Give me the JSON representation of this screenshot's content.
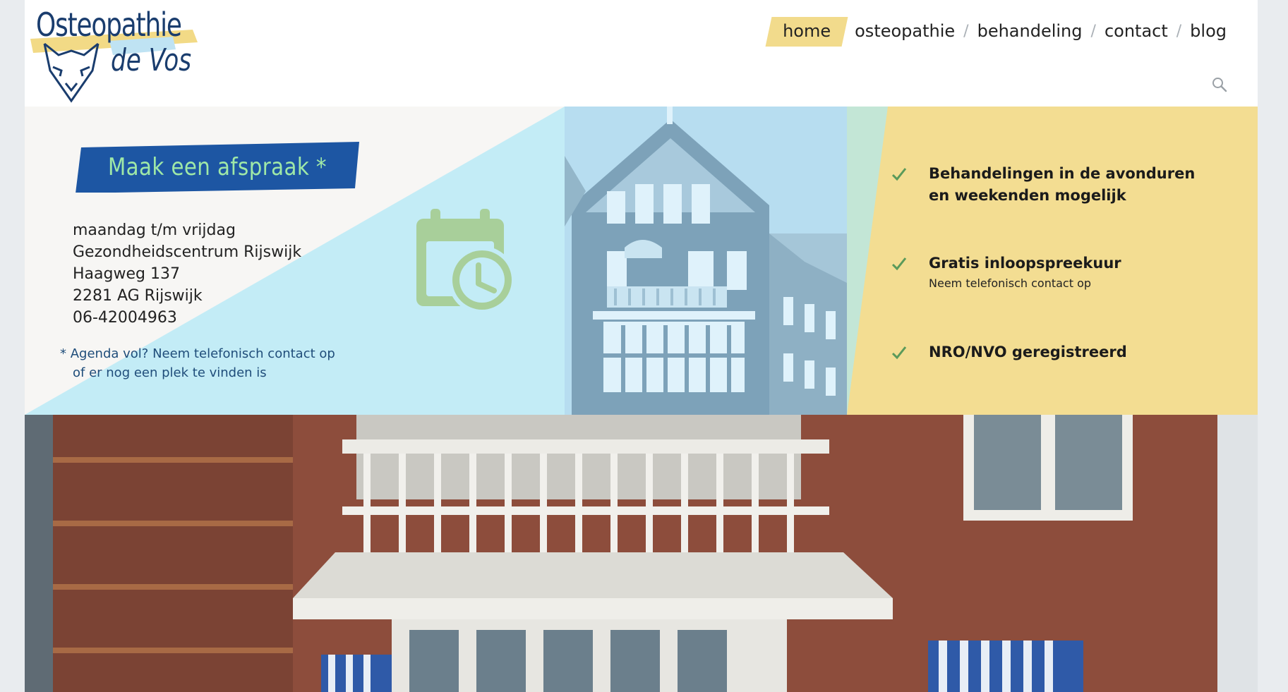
{
  "logo": {
    "title": "Osteopathie",
    "subtitle": "de Vos"
  },
  "nav": {
    "items": [
      {
        "label": "home"
      },
      {
        "label": "osteopathie"
      },
      {
        "label": "behandeling"
      },
      {
        "label": "contact"
      },
      {
        "label": "blog"
      }
    ],
    "separator": "/"
  },
  "appointment": {
    "button_label": "Maak een afspraak *",
    "address": [
      "maandag t/m vrijdag",
      "Gezondheidscentrum Rijswijk",
      "Haagweg 137",
      "2281 AG Rijswijk",
      "06-42004963"
    ],
    "note": [
      "* Agenda vol? Neem telefonisch contact op",
      "of er nog een plek te vinden is"
    ]
  },
  "features": [
    {
      "title_lines": [
        "Behandelingen in de avonduren",
        "en weekenden mogelijk"
      ],
      "sub": ""
    },
    {
      "title_lines": [
        "Gratis inloopspreekuur"
      ],
      "sub": "Neem telefonisch contact op"
    },
    {
      "title_lines": [
        "NRO/NVO geregistreerd"
      ],
      "sub": ""
    }
  ],
  "colors": {
    "brand_blue": "#1a3d6e",
    "cta_blue": "#1d56a3",
    "cta_text": "#9fe8a7",
    "light_blue": "#c3ecf6",
    "yellow": "#f3dd92",
    "check_green": "#5a9a5a"
  }
}
